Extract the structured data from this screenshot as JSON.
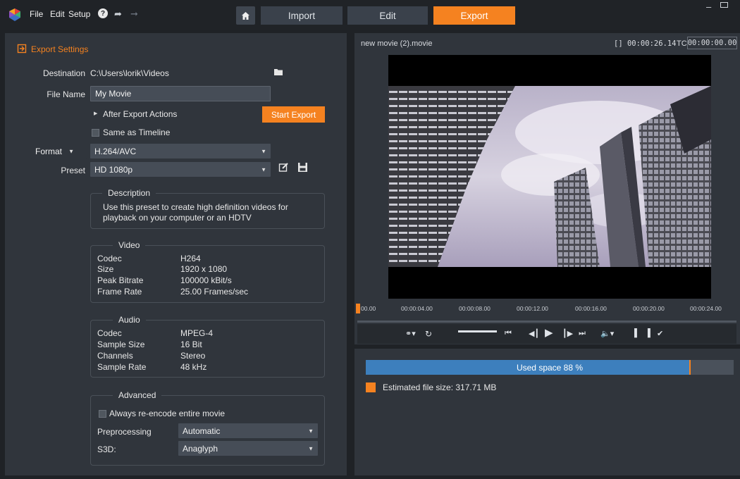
{
  "menu": {
    "file": "File",
    "edit": "Edit",
    "setup": "Setup",
    "help": "?"
  },
  "tabs": {
    "import": "Import",
    "edit": "Edit",
    "export": "Export"
  },
  "export_settings": {
    "title": "Export Settings",
    "destination_label": "Destination",
    "destination_value": "C:\\Users\\lorik\\Videos",
    "file_name_label": "File Name",
    "file_name_value": "My Movie",
    "after_export_actions": "After Export Actions",
    "start_export": "Start Export",
    "same_as_timeline": "Same as Timeline",
    "format_label": "Format",
    "format_value": "H.264/AVC",
    "preset_label": "Preset",
    "preset_value": "HD 1080p"
  },
  "description": {
    "title": "Description",
    "text_line1": "Use this preset to create high definition videos for",
    "text_line2": "playback on your computer or an HDTV"
  },
  "video": {
    "title": "Video",
    "rows": [
      {
        "label": "Codec",
        "value": "H264"
      },
      {
        "label": "Size",
        "value": "1920 x 1080"
      },
      {
        "label": "Peak Bitrate",
        "value": "100000 kBit/s"
      },
      {
        "label": "Frame Rate",
        "value": "25.00 Frames/sec"
      }
    ]
  },
  "audio": {
    "title": "Audio",
    "rows": [
      {
        "label": "Codec",
        "value": "MPEG-4"
      },
      {
        "label": "Sample Size",
        "value": "16 Bit"
      },
      {
        "label": "Channels",
        "value": "Stereo"
      },
      {
        "label": "Sample Rate",
        "value": "48 kHz"
      }
    ]
  },
  "advanced": {
    "title": "Advanced",
    "reencode": "Always re-encode entire movie",
    "preprocessing_label": "Preprocessing",
    "preprocessing_value": "Automatic",
    "s3d_label": "S3D:",
    "s3d_value": "Anaglyph"
  },
  "preview": {
    "movie_name": "new movie (2).movie",
    "duration": "[] 00:00:26.14",
    "tc_label": "TC",
    "tc_value": "00:00:00.00",
    "timeline_ticks": [
      "00.00",
      "00:00:04.00",
      "00:00:08.00",
      "00:00:12.00",
      "00:00:16.00",
      "00:00:20.00",
      "00:00:24.00"
    ]
  },
  "storage": {
    "used_label": "Used space 88 %",
    "used_fraction": 0.88,
    "estimated_label": "Estimated file size: 317.71 MB"
  },
  "colors": {
    "accent": "#f58220",
    "bar": "#3d7fbd"
  }
}
